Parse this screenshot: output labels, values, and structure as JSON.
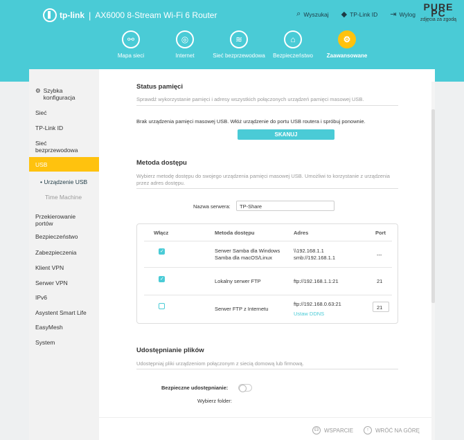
{
  "header": {
    "brand": "tp-link",
    "model": "AX6000 8-Stream Wi-Fi 6 Router",
    "links": [
      {
        "label": "Wyszukaj",
        "icon": "search-icon"
      },
      {
        "label": "TP-Link ID",
        "icon": "user-icon"
      },
      {
        "label": "Wylog",
        "icon": "logout-icon"
      }
    ],
    "badge_line1": "PURE PC",
    "badge_line2": "zdjęcia za zgodą"
  },
  "nav": [
    {
      "label": "Mapa sieci",
      "icon": "network-map-icon"
    },
    {
      "label": "Internet",
      "icon": "globe-icon"
    },
    {
      "label": "Sieć bezprzewodowa",
      "icon": "wifi-icon"
    },
    {
      "label": "Bezpieczeństwo",
      "icon": "shield-icon"
    },
    {
      "label": "Zaawansowane",
      "icon": "gear-icon",
      "active": true
    }
  ],
  "sidebar": {
    "quick_setup": "Szybka konfiguracja",
    "items": [
      "Sieć",
      "TP-Link ID",
      "Sieć bezprzewodowa",
      "USB"
    ],
    "usb_sub": [
      "Urządzenie USB",
      "Time Machine"
    ],
    "items2": [
      "Przekierowanie portów",
      "Bezpieczeństwo",
      "Zabezpieczenia",
      "Klient VPN",
      "Serwer VPN",
      "IPv6",
      "Asystent Smart Life",
      "EasyMesh",
      "System"
    ]
  },
  "storage": {
    "title": "Status pamięci",
    "desc": "Sprawdź wykorzystanie pamięci i adresy wszystkich połączonych urządzeń pamięci masowej USB.",
    "no_device": "Brak urządzenia pamięci masowej USB. Włóż urządzenie do portu USB routera i spróbuj ponownie.",
    "scan_button": "SKANUJ"
  },
  "access": {
    "title": "Metoda dostępu",
    "desc": "Wybierz metodę dostępu do swojego urządzenia pamięci masowej USB. Umożliwi to korzystanie z urządzenia przez adres dostępu.",
    "server_name_label": "Nazwa serwera:",
    "server_name_value": "TP-Share",
    "columns": [
      "Włącz",
      "Metoda dostępu",
      "Adres",
      "Port"
    ],
    "rows": [
      {
        "enabled": true,
        "method": "Serwer Samba dla Windows",
        "method2": "Samba dla macOS/Linux",
        "address": "\\\\192.168.1.1",
        "address2": "smb://192.168.1.1",
        "port": "---"
      },
      {
        "enabled": true,
        "method": "Lokalny serwer FTP",
        "method2": "",
        "address": "ftp://192.168.1.1:21",
        "address2": "",
        "port": "21"
      },
      {
        "enabled": false,
        "method": "Serwer FTP z Internetu",
        "method2": "",
        "address": "ftp://192.168.0.63:21",
        "address2": "",
        "ddns_link": "Ustaw DDNS",
        "port": "21"
      }
    ]
  },
  "sharing": {
    "title": "Udostępnianie plików",
    "desc": "Udostępniaj pliki urządzeniom połączonym z siecią domową lub firmową.",
    "secure_label": "Bezpieczne udostępnianie:",
    "folder_label": "Wybierz folder:"
  },
  "footer": {
    "support": "WSPARCIE",
    "back_top": "WRÓĆ NA GÓRĘ"
  }
}
